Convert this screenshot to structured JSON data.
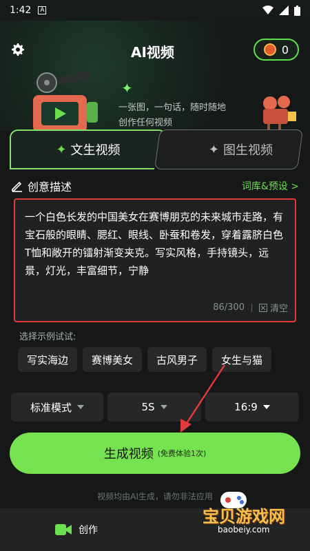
{
  "status": {
    "time": "1:42"
  },
  "header": {
    "title": "AI视频",
    "coin_count": "0",
    "tagline_line1": "一张图，一句话，随时随地",
    "tagline_line2": "创作任何视频"
  },
  "tabs": [
    {
      "label": "文生视频",
      "active": true
    },
    {
      "label": "图生视频",
      "active": false
    }
  ],
  "section": {
    "title": "创意描述",
    "link": "词库&预设 >"
  },
  "description": {
    "text": "一个白色长发的中国美女在赛博朋克的未来城市走路，有宝石般的眼睛、腮红、眼线、卧蚕和卷发，穿着露脐白色T恤和敞开的镭射渐变夹克。写实风格，手持镜头，远景，灯光，丰富细节，宁静",
    "counter": "86/300",
    "clear": "清空"
  },
  "examples": {
    "label": "选择示例试试:",
    "chips": [
      "写实海边",
      "赛博美女",
      "古风男子",
      "女生与猫"
    ]
  },
  "options": {
    "mode": "标准模式",
    "duration": "5S",
    "ratio": "16:9"
  },
  "generate": {
    "label": "生成视频",
    "sub": "(免费体验1次)"
  },
  "notice": "视频均由AI生成，请勿非法应用",
  "bottom_nav": {
    "create": "创作"
  },
  "watermark": {
    "text": "宝贝游戏网",
    "url": "baobeiy.com"
  },
  "colors": {
    "accent": "#77e24f",
    "highlight_border": "#e03a3a"
  }
}
